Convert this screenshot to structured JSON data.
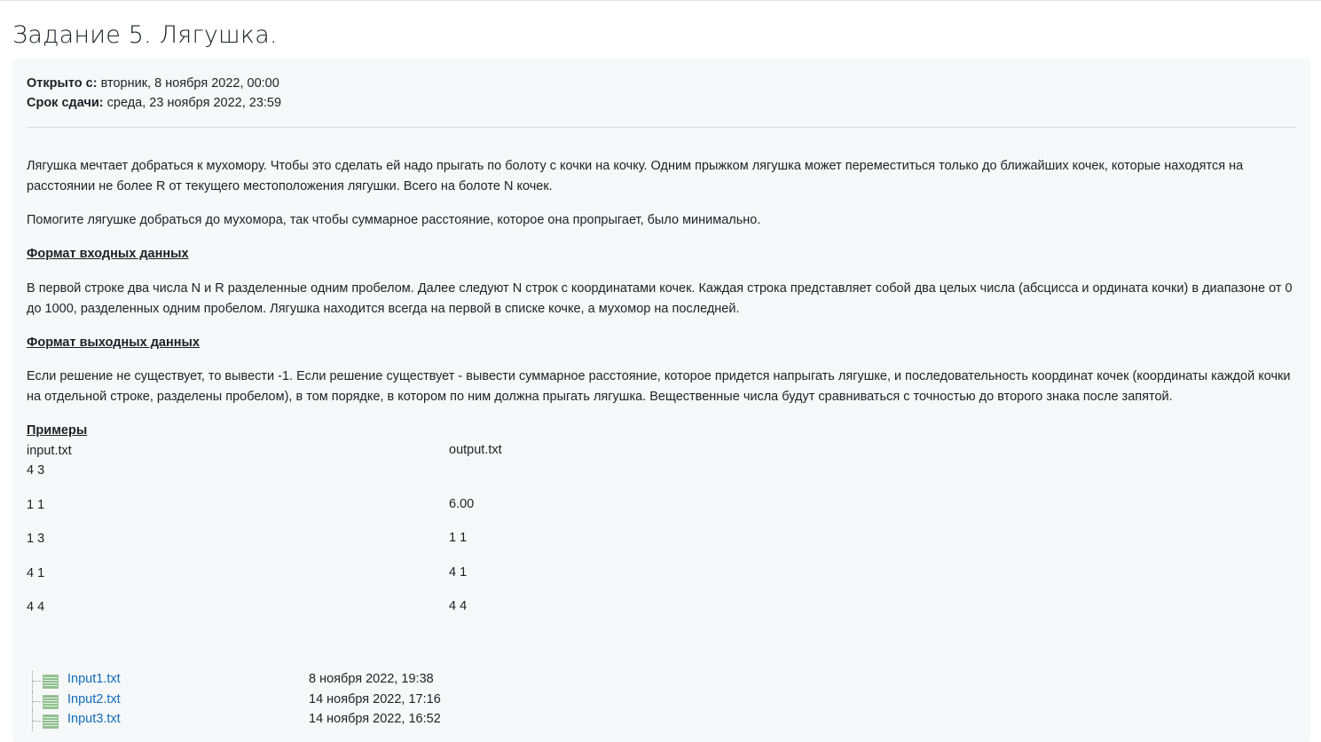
{
  "title": "Задание 5. Лягушка.",
  "dates": {
    "opened_label": "Открыто с:",
    "opened_value": "вторник, 8 ноября 2022, 00:00",
    "due_label": "Срок сдачи:",
    "due_value": "среда, 23 ноября 2022, 23:59"
  },
  "description": {
    "p1": "Лягушка мечтает добраться к мухомору. Чтобы это сделать ей надо прыгать по болоту с кочки на кочку. Одним прыжком лягушка может переместиться только до ближайших кочек, которые находятся на расстоянии не более R от текущего местоположения лягушки. Всего на болоте N кочек.",
    "p2": "Помогите лягушке добраться до мухомора, так чтобы суммарное расстояние, которое она пропрыгает, было минимально.",
    "input_heading": "Формат входных данных",
    "input_text": "В первой строке два числа N и R разделенные одним пробелом. Далее следуют N строк с координатами кочек. Каждая строка представляет собой два целых числа (абсцисса и ордината кочки) в диапазоне от 0 до 1000, разделенных одним пробелом. Лягушка находится всегда на первой в списке кочке, а мухомор на последней.",
    "output_heading": "Формат выходных данных",
    "output_text": "Если решение не существует, то вывести -1. Если решение существует - вывести суммарное расстояние, которое придется напрыгать лягушке, и последовательность координат кочек (координаты каждой кочки на отдельной строке, разделены пробелом), в том порядке, в котором по ним должна прыгать лягушка. Вещественные числа будут сравниваться с точностью до второго знака после запятой.",
    "examples_heading": "Примеры"
  },
  "example": {
    "input_header": "input.txt",
    "output_header": "output.txt",
    "input_lines": [
      "4 3",
      "1 1",
      "1 3",
      "4 1",
      "4 4"
    ],
    "output_lines": [
      "6.00",
      "1 1",
      "4 1",
      "4 4"
    ]
  },
  "files": [
    {
      "name": "Input1.txt",
      "date": "8 ноября 2022, 19:38"
    },
    {
      "name": "Input2.txt",
      "date": "14 ноября 2022, 17:16"
    },
    {
      "name": "Input3.txt",
      "date": "14 ноября 2022, 16:52"
    }
  ],
  "colors": {
    "link": "#0f6cbf",
    "panel_bg": "#f7f8f9",
    "text": "#1d2125"
  }
}
